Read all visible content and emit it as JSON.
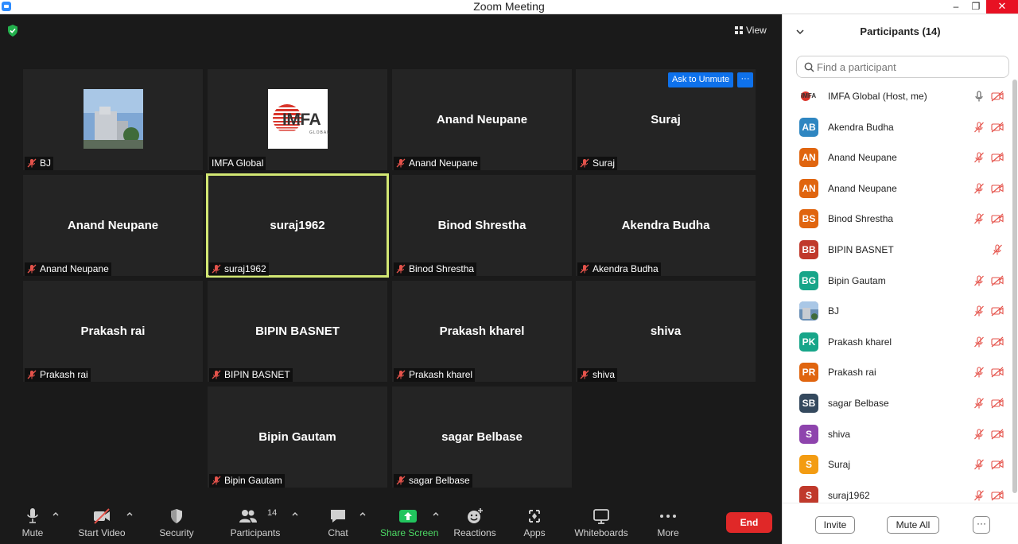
{
  "window": {
    "title": "Zoom Meeting",
    "minimize": "–",
    "maximize": "❐",
    "close": "✕"
  },
  "view_label": "View",
  "ask_to_unmute": "Ask to Unmute",
  "more_dots": "···",
  "tiles": [
    {
      "name": "BJ",
      "label": "BJ",
      "type": "photo"
    },
    {
      "name": "IMFA Global",
      "label": "IMFA Global",
      "type": "logo"
    },
    {
      "name": "Anand Neupane",
      "label": "Anand Neupane",
      "type": "name"
    },
    {
      "name": "Suraj",
      "label": "Suraj",
      "type": "name"
    },
    {
      "name": "Anand Neupane",
      "label": "Anand Neupane",
      "type": "name"
    },
    {
      "name": "suraj1962",
      "label": "suraj1962",
      "type": "name",
      "active": true
    },
    {
      "name": "Binod Shrestha",
      "label": "Binod Shrestha",
      "type": "name"
    },
    {
      "name": "Akendra Budha",
      "label": "Akendra Budha",
      "type": "name"
    },
    {
      "name": "Prakash rai",
      "label": "Prakash rai",
      "type": "name"
    },
    {
      "name": "BIPIN BASNET",
      "label": "BIPIN BASNET",
      "type": "name"
    },
    {
      "name": "Prakash kharel",
      "label": "Prakash kharel",
      "type": "name"
    },
    {
      "name": "shiva",
      "label": "shiva",
      "type": "name"
    },
    {
      "name": "Bipin Gautam",
      "label": "Bipin Gautam",
      "type": "name"
    },
    {
      "name": "sagar Belbase",
      "label": "sagar Belbase",
      "type": "name"
    }
  ],
  "imfa_logo": {
    "text": "IMFA",
    "sub": "GLOBAL"
  },
  "toolbar": {
    "mute": "Mute",
    "start_video": "Start Video",
    "security": "Security",
    "participants": "Participants",
    "participants_count": "14",
    "chat": "Chat",
    "share_screen": "Share Screen",
    "reactions": "Reactions",
    "apps": "Apps",
    "whiteboards": "Whiteboards",
    "more": "More",
    "end": "End"
  },
  "panel": {
    "title": "Participants (14)",
    "search_placeholder": "Find a participant",
    "invite": "Invite",
    "mute_all": "Mute All",
    "more": "···"
  },
  "participants": [
    {
      "name": "IMFA Global (Host, me)",
      "initials": "IMFA",
      "color": "#ffffff",
      "avatar": "logo",
      "mic": "on",
      "cam": "off"
    },
    {
      "name": "Akendra Budha",
      "initials": "AB",
      "color": "#2e86c1",
      "mic": "off",
      "cam": "off"
    },
    {
      "name": "Anand Neupane",
      "initials": "AN",
      "color": "#e0650f",
      "mic": "off",
      "cam": "off"
    },
    {
      "name": "Anand Neupane",
      "initials": "AN",
      "color": "#e0650f",
      "mic": "off",
      "cam": "off"
    },
    {
      "name": "Binod Shrestha",
      "initials": "BS",
      "color": "#e0650f",
      "mic": "off",
      "cam": "off"
    },
    {
      "name": "BIPIN BASNET",
      "initials": "BB",
      "color": "#c0392b",
      "mic": "off",
      "cam": "none"
    },
    {
      "name": "Bipin Gautam",
      "initials": "BG",
      "color": "#17a589",
      "mic": "off",
      "cam": "off"
    },
    {
      "name": "BJ",
      "initials": "",
      "color": "#6a8fb5",
      "avatar": "photo",
      "mic": "off",
      "cam": "off"
    },
    {
      "name": "Prakash kharel",
      "initials": "PK",
      "color": "#17a589",
      "mic": "off",
      "cam": "off"
    },
    {
      "name": "Prakash rai",
      "initials": "PR",
      "color": "#e0650f",
      "mic": "off",
      "cam": "off"
    },
    {
      "name": "sagar Belbase",
      "initials": "SB",
      "color": "#34495e",
      "mic": "off",
      "cam": "off"
    },
    {
      "name": "shiva",
      "initials": "S",
      "color": "#8e44ad",
      "mic": "off",
      "cam": "off"
    },
    {
      "name": "Suraj",
      "initials": "S",
      "color": "#f39c12",
      "mic": "off",
      "cam": "off"
    },
    {
      "name": "suraj1962",
      "initials": "S",
      "color": "#c0392b",
      "mic": "off",
      "cam": "off"
    }
  ],
  "colors": {
    "accent_blue": "#0e71eb",
    "end_red": "#e02828",
    "active_speaker": "#d2e773",
    "share_green": "#22c55e",
    "mute_red": "#e5534b"
  }
}
